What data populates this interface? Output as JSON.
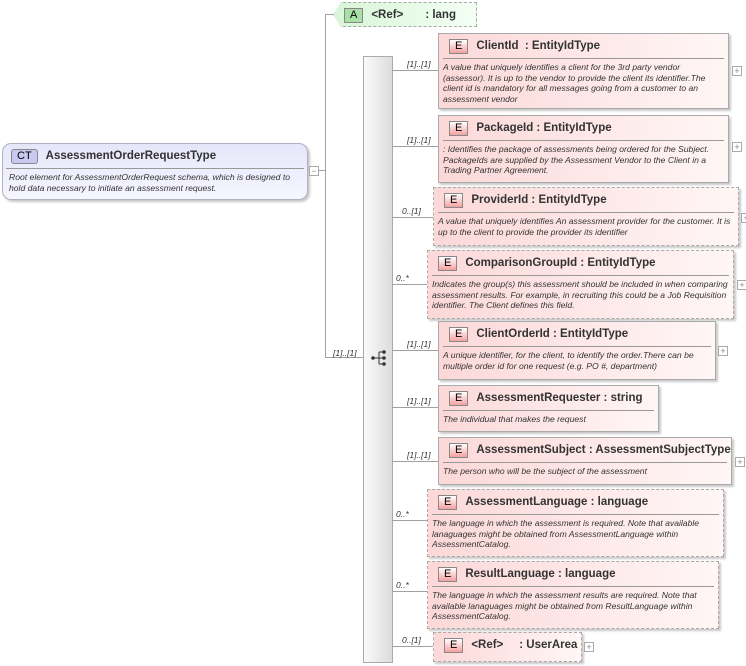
{
  "complex_type": {
    "badge": "CT",
    "name": "AssessmentOrderRequestType",
    "description": "Root element for AssessmentOrderRequest schema, which is designed to hold data necessary to initiate an assessment request."
  },
  "attribute": {
    "badge": "A",
    "ref": "<Ref>",
    "name": ": lang"
  },
  "sequence_multiplicity": "[1]..[1]",
  "elements": [
    {
      "badge": "E",
      "title": "ClientId  : EntityIdType",
      "mult": "[1]..[1]",
      "optional": false,
      "expandable": true,
      "description": "A value that uniquely identifies a client for the 3rd party vendor (assessor). It is up to the vendor to provide the client its identifier.The client id is mandatory for all messages going from a customer to an assessment vendor"
    },
    {
      "badge": "E",
      "title": "PackageId : EntityIdType",
      "mult": "[1]..[1]",
      "optional": false,
      "expandable": true,
      "description": ": Identifies the package of assessments being ordered for the Subject. PackageIds are supplied by the Assessment Vendor to the Client in a Trading Partner Agreement."
    },
    {
      "badge": "E",
      "title": "ProviderId : EntityIdType",
      "mult": "0..[1]",
      "optional": true,
      "expandable": true,
      "description": "A value that uniquely identifies An assessment provider for the customer. It is up to the client to provide the provider its identifier"
    },
    {
      "badge": "E",
      "title": "ComparisonGroupId : EntityIdType",
      "mult": "0..*",
      "optional": true,
      "expandable": true,
      "description": "Indicates the group(s) this assessment should be included in when comparing assessment results.  For example, in recruiting this could be a Job Requisition identifier. The Client defines this field."
    },
    {
      "badge": "E",
      "title": "ClientOrderId : EntityIdType",
      "mult": "[1]..[1]",
      "optional": false,
      "expandable": true,
      "description": "A unique identifier, for the client, to identify the order.There can be multiple order id for one request (e.g. PO #, department)"
    },
    {
      "badge": "E",
      "title": "AssessmentRequester : string",
      "mult": "[1]..[1]",
      "optional": false,
      "expandable": false,
      "description": "The individual that makes the request"
    },
    {
      "badge": "E",
      "title": "AssessmentSubject : AssessmentSubjectType",
      "mult": "[1]..[1]",
      "optional": false,
      "expandable": true,
      "description": "The person who will be the subject of the assessment"
    },
    {
      "badge": "E",
      "title": "AssessmentLanguage : language",
      "mult": "0..*",
      "optional": true,
      "expandable": false,
      "description": "The language in which the assessment is required. Note that  available lanaguages might be obtained from AssessmentLanguage within AssessmentCatalog."
    },
    {
      "badge": "E",
      "title": "ResultLanguage : language",
      "mult": "0..*",
      "optional": true,
      "expandable": false,
      "description": "The language in which the assessment results are required. Note that available lanaguages might be obtained from ResultLanguage within AssessmentCatalog."
    },
    {
      "badge": "E",
      "title": "<Ref>     : UserArea",
      "mult": "0..[1]",
      "optional": true,
      "expandable": true,
      "description": ""
    }
  ]
}
